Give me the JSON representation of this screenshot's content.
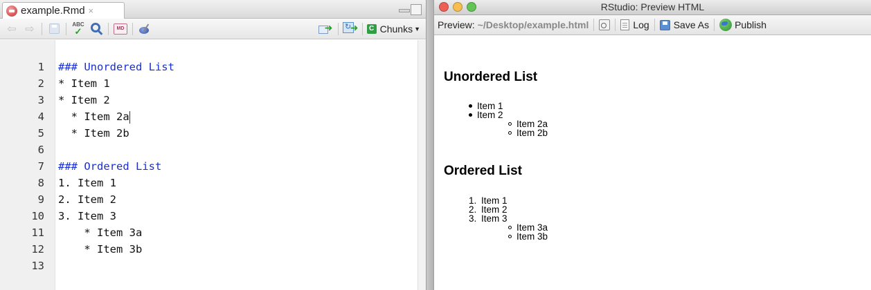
{
  "editor": {
    "tab_title": "example.Rmd",
    "tab_close": "×",
    "toolbar": {
      "md_label": "MD",
      "abc_label": "ABC",
      "chunks_label": "Chunks"
    },
    "lines": [
      {
        "num": "1",
        "text": "### Unordered List",
        "heading": true
      },
      {
        "num": "2",
        "text": "* Item 1"
      },
      {
        "num": "3",
        "text": "* Item 2"
      },
      {
        "num": "4",
        "text": "  * Item 2a",
        "cursor": true
      },
      {
        "num": "5",
        "text": "  * Item 2b"
      },
      {
        "num": "6",
        "text": ""
      },
      {
        "num": "7",
        "text": "### Ordered List",
        "heading": true
      },
      {
        "num": "8",
        "text": "1. Item 1"
      },
      {
        "num": "9",
        "text": "2. Item 2"
      },
      {
        "num": "10",
        "text": "3. Item 3"
      },
      {
        "num": "11",
        "text": "    * Item 3a"
      },
      {
        "num": "12",
        "text": "    * Item 3b"
      },
      {
        "num": "13",
        "text": ""
      }
    ]
  },
  "preview": {
    "window_title": "RStudio: Preview HTML",
    "toolbar": {
      "preview_label": "Preview:",
      "path": "~/Desktop/example.html",
      "log_label": "Log",
      "save_as_label": "Save As",
      "publish_label": "Publish"
    },
    "traffic_lights": {
      "close": "#ec5f57",
      "minimize": "#f5be4f",
      "zoom": "#62c454"
    },
    "document": {
      "unordered_heading": "Unordered List",
      "unordered_items": [
        {
          "label": "Item 1"
        },
        {
          "label": "Item 2",
          "children": [
            "Item 2a",
            "Item 2b"
          ]
        }
      ],
      "ordered_heading": "Ordered List",
      "ordered_items": [
        {
          "num": "1.",
          "label": "Item 1"
        },
        {
          "num": "2.",
          "label": "Item 2"
        },
        {
          "num": "3.",
          "label": "Item 3",
          "children": [
            "Item 3a",
            "Item 3b"
          ]
        }
      ]
    }
  }
}
